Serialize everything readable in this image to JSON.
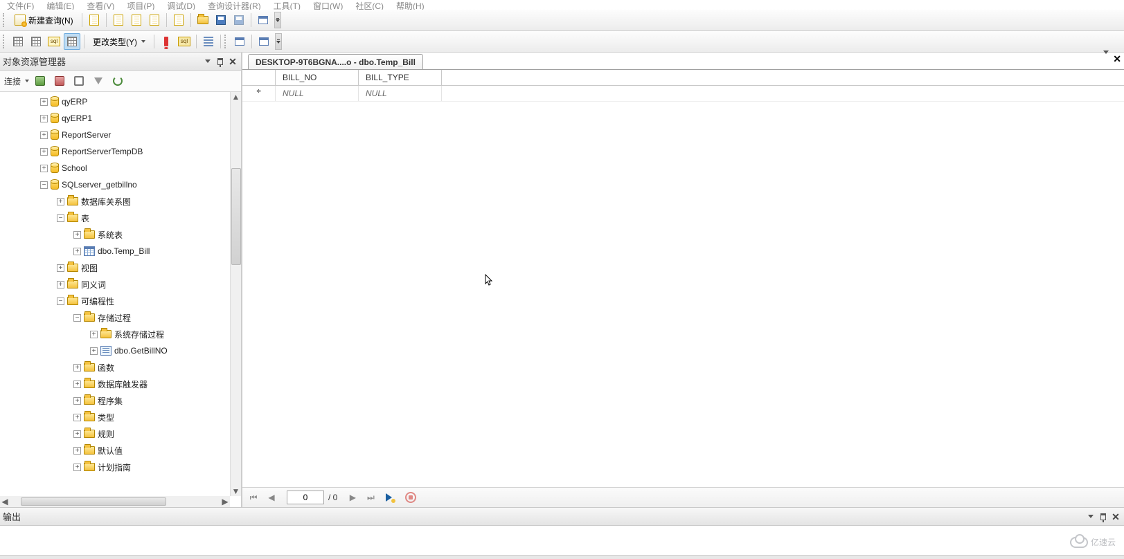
{
  "menubar": [
    "文件(F)",
    "编辑(E)",
    "查看(V)",
    "项目(P)",
    "调试(D)",
    "查询设计器(R)",
    "工具(T)",
    "窗口(W)",
    "社区(C)",
    "帮助(H)"
  ],
  "toolbar1": {
    "new_query_label": "新建查询(N)"
  },
  "toolbar2": {
    "change_type_label": "更改类型(Y)",
    "sql_label": "sql"
  },
  "object_explorer": {
    "title": "对象资源管理器",
    "connect_label": "连接"
  },
  "tree": [
    {
      "indent": 1,
      "exp": "plus",
      "icon": "db",
      "label": "qyERP"
    },
    {
      "indent": 1,
      "exp": "plus",
      "icon": "db",
      "label": "qyERP1"
    },
    {
      "indent": 1,
      "exp": "plus",
      "icon": "db",
      "label": "ReportServer"
    },
    {
      "indent": 1,
      "exp": "plus",
      "icon": "db",
      "label": "ReportServerTempDB"
    },
    {
      "indent": 1,
      "exp": "plus",
      "icon": "db",
      "label": "School"
    },
    {
      "indent": 1,
      "exp": "minus",
      "icon": "db",
      "label": "SQLserver_getbillno"
    },
    {
      "indent": 2,
      "exp": "plus",
      "icon": "folder",
      "label": "数据库关系图"
    },
    {
      "indent": 2,
      "exp": "minus",
      "icon": "folder",
      "label": "表"
    },
    {
      "indent": 3,
      "exp": "plus",
      "icon": "folder",
      "label": "系统表"
    },
    {
      "indent": 3,
      "exp": "plus",
      "icon": "table",
      "label": "dbo.Temp_Bill"
    },
    {
      "indent": 2,
      "exp": "plus",
      "icon": "folder",
      "label": "视图"
    },
    {
      "indent": 2,
      "exp": "plus",
      "icon": "folder",
      "label": "同义词"
    },
    {
      "indent": 2,
      "exp": "minus",
      "icon": "folder",
      "label": "可编程性"
    },
    {
      "indent": 3,
      "exp": "minus",
      "icon": "folder",
      "label": "存储过程"
    },
    {
      "indent": 4,
      "exp": "plus",
      "icon": "folder",
      "label": "系统存储过程"
    },
    {
      "indent": 4,
      "exp": "plus",
      "icon": "proc",
      "label": "dbo.GetBillNO"
    },
    {
      "indent": 3,
      "exp": "plus",
      "icon": "folder",
      "label": "函数"
    },
    {
      "indent": 3,
      "exp": "plus",
      "icon": "folder",
      "label": "数据库触发器"
    },
    {
      "indent": 3,
      "exp": "plus",
      "icon": "folder",
      "label": "程序集"
    },
    {
      "indent": 3,
      "exp": "plus",
      "icon": "folder",
      "label": "类型"
    },
    {
      "indent": 3,
      "exp": "plus",
      "icon": "folder",
      "label": "规则"
    },
    {
      "indent": 3,
      "exp": "plus",
      "icon": "folder",
      "label": "默认值"
    },
    {
      "indent": 3,
      "exp": "plus",
      "icon": "folder",
      "label": "计划指南"
    }
  ],
  "tab_title": "DESKTOP-9T6BGNA....o - dbo.Temp_Bill",
  "grid": {
    "columns": [
      "BILL_NO",
      "BILL_TYPE"
    ],
    "new_row_marker": "*",
    "rows": [
      {
        "values": [
          "NULL",
          "NULL"
        ],
        "is_null": [
          true,
          true
        ]
      }
    ]
  },
  "nav": {
    "current": "0",
    "total": "/ 0"
  },
  "output": {
    "title": "输出"
  },
  "watermark": "亿速云"
}
